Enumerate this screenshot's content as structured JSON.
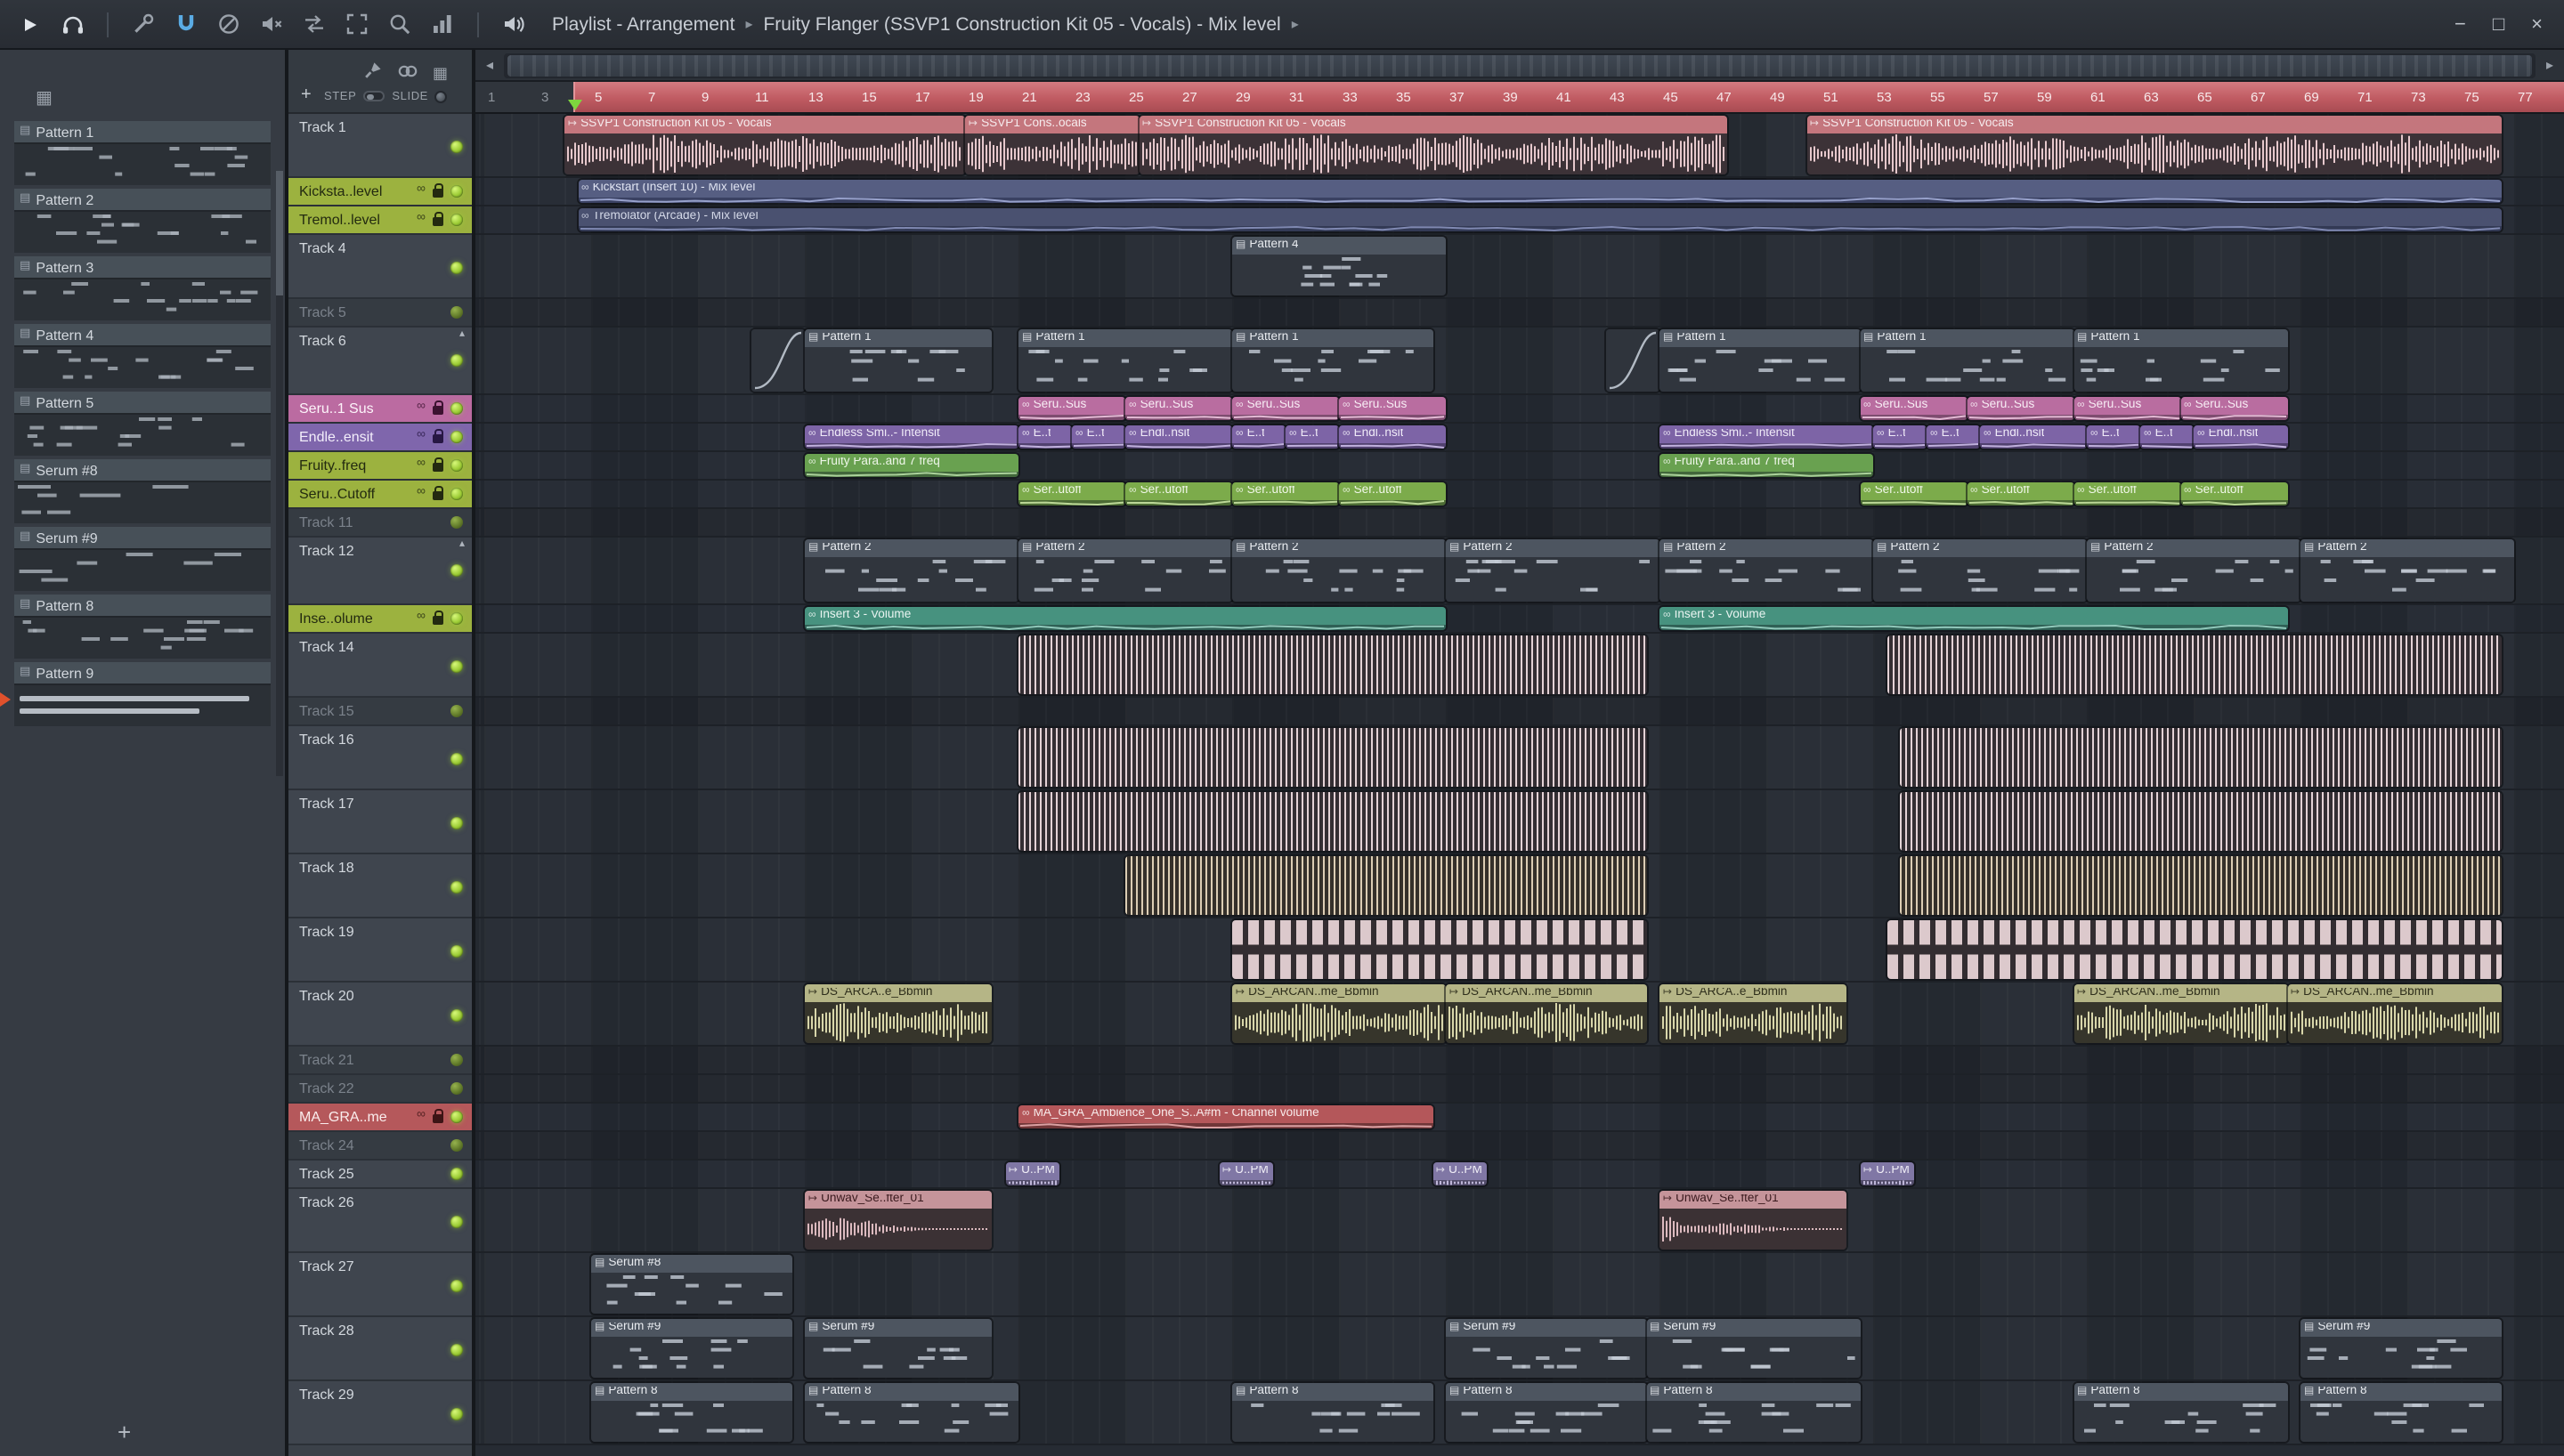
{
  "window": {
    "breadcrumb": {
      "segments": [
        "Playlist - Arrangement",
        "Fruity Flanger (SSVP1 Construction Kit 05 - Vocals) - Mix level"
      ],
      "separator": "▸"
    },
    "controls": {
      "minimize": "−",
      "maximize": "□",
      "close": "×"
    }
  },
  "icons": {
    "pattern": "▤",
    "audio": "↦",
    "auto": "∞",
    "link": "∞",
    "collapse": "▴",
    "grid": "▦"
  },
  "pattern_picker": {
    "items": [
      {
        "name": "Pattern 1",
        "preview": "notes"
      },
      {
        "name": "Pattern 2",
        "preview": "notes"
      },
      {
        "name": "Pattern 3",
        "preview": "notes-sparse"
      },
      {
        "name": "Pattern 4",
        "preview": "notes"
      },
      {
        "name": "Pattern 5",
        "preview": "notes"
      },
      {
        "name": "Serum #8",
        "preview": "notes-long"
      },
      {
        "name": "Serum #9",
        "preview": "notes-long"
      },
      {
        "name": "Pattern 8",
        "preview": "notes"
      },
      {
        "name": "Pattern 9",
        "preview": "bars",
        "playing": true
      }
    ],
    "add_button": "+"
  },
  "playlist_toolbar": {
    "add_button": "+",
    "step_label": "STEP",
    "slide_label": "SLIDE",
    "scroll_left": "◂",
    "scroll_right": "▸"
  },
  "timeline": {
    "bar_labels": [
      1,
      3,
      5,
      7,
      9,
      11,
      13,
      15,
      17,
      19,
      21,
      23,
      25,
      27,
      29,
      31,
      33,
      35,
      37,
      39,
      41,
      43,
      45,
      47,
      49,
      51,
      53,
      55,
      57,
      59,
      61,
      63,
      65,
      67,
      69,
      71,
      73,
      75,
      77
    ],
    "loop_start_bar": 4.3,
    "playhead_bar": 4.4
  },
  "tracks": [
    {
      "name": "Track 1",
      "kind": "tall",
      "h": 36
    },
    {
      "name": "Kicksta..level",
      "kind": "auto",
      "h": 16,
      "color": "green"
    },
    {
      "name": "Tremol..level",
      "kind": "auto",
      "h": 16,
      "color": "green"
    },
    {
      "name": "Track 4",
      "kind": "tall",
      "h": 36
    },
    {
      "name": "Track 5",
      "kind": "dim",
      "h": 16
    },
    {
      "name": "Track 6",
      "kind": "tall",
      "h": 38,
      "arrow": true
    },
    {
      "name": "Seru..1 Sus",
      "kind": "auto",
      "h": 16,
      "color": "magenta"
    },
    {
      "name": "Endle..ensit",
      "kind": "auto",
      "h": 16,
      "color": "purple"
    },
    {
      "name": "Fruity..freq",
      "kind": "auto",
      "h": 16,
      "color": "green"
    },
    {
      "name": "Seru..Cutoff",
      "kind": "auto",
      "h": 16,
      "color": "green"
    },
    {
      "name": "Track 11",
      "kind": "dim",
      "h": 16
    },
    {
      "name": "Track 12",
      "kind": "tall",
      "h": 38,
      "arrow": true
    },
    {
      "name": "Inse..olume",
      "kind": "auto",
      "h": 16,
      "color": "green"
    },
    {
      "name": "Track 14",
      "kind": "tall",
      "h": 36
    },
    {
      "name": "Track 15",
      "kind": "dim",
      "h": 16
    },
    {
      "name": "Track 16",
      "kind": "tall",
      "h": 36
    },
    {
      "name": "Track 17",
      "kind": "tall",
      "h": 36
    },
    {
      "name": "Track 18",
      "kind": "tall",
      "h": 36
    },
    {
      "name": "Track 19",
      "kind": "tall",
      "h": 36
    },
    {
      "name": "Track 20",
      "kind": "tall",
      "h": 36
    },
    {
      "name": "Track 21",
      "kind": "dim",
      "h": 16
    },
    {
      "name": "Track 22",
      "kind": "dim",
      "h": 16
    },
    {
      "name": "MA_GRA..me",
      "kind": "auto",
      "h": 16,
      "color": "red"
    },
    {
      "name": "Track 24",
      "kind": "dim",
      "h": 16
    },
    {
      "name": "Track 25",
      "kind": "small",
      "h": 16
    },
    {
      "name": "Track 26",
      "kind": "tall",
      "h": 36
    },
    {
      "name": "Track 27",
      "kind": "tall",
      "h": 36
    },
    {
      "name": "Track 28",
      "kind": "tall",
      "h": 36
    },
    {
      "name": "Track 29",
      "kind": "tall",
      "h": 36
    }
  ],
  "track_colors": {
    "green": {
      "bg": "#9cb23f",
      "text": "#232a10",
      "ink": "#232a10"
    },
    "magenta": {
      "bg": "#bb6ba1",
      "text": "#fdf4fa",
      "ink": "#3c1230"
    },
    "purple": {
      "bg": "#7f66ac",
      "text": "#f3eefb",
      "ink": "#271743"
    },
    "red": {
      "bg": "#b5585b",
      "text": "#faeded",
      "ink": "#3d1415"
    }
  },
  "palettes": {
    "vocal": {
      "head": "#c4767d",
      "text": "#f6ecee",
      "body": "#3c3237",
      "wave": "#e6c8cc"
    },
    "indigo": {
      "head": "#565e82",
      "text": "#e0e4f2",
      "body": "#3a4162",
      "line": "#98a2cc"
    },
    "indigo2": {
      "head": "#4a5170",
      "text": "#d4d9e8",
      "body": "#333a55",
      "line": "#8089b2"
    },
    "gray": {
      "head": "#4d5560",
      "text": "#e9ecf0",
      "body": "#30353d",
      "note": "#c3cbd4"
    },
    "grayc": {
      "head": "#454c56",
      "text": "#dfe3e8",
      "body": "#2f343c",
      "line": "#b2bac4"
    },
    "magenta": {
      "head": "#b96da0",
      "text": "#f8eef5",
      "body": "#7e4d70",
      "line": "#e3b9d4"
    },
    "purple": {
      "head": "#7d64a6",
      "text": "#f0ebf8",
      "body": "#51416f",
      "line": "#c0b0dd"
    },
    "green": {
      "head": "#69a150",
      "text": "#eef6e9",
      "body": "#42673b",
      "line": "#abd29b"
    },
    "green2": {
      "head": "#7cab4b",
      "text": "#f1f7e9",
      "body": "#4c6b34",
      "line": "#bcd897"
    },
    "teal": {
      "head": "#47927f",
      "text": "#e9f4f1",
      "body": "#2f6055",
      "line": "#90c8ba"
    },
    "red": {
      "head": "#b4575a",
      "text": "#f8ebeb",
      "body": "#703638",
      "line": "#daa0a2"
    },
    "lavender": {
      "head": "#8077a5",
      "text": "#f0eef7",
      "body": "#514b69",
      "wave": "#beb6d8"
    },
    "rose": {
      "head": "#c5949a",
      "text": "#39191d",
      "body": "#3b3134",
      "wave": "#dcbabf"
    },
    "olive": {
      "head": "#b5b586",
      "text": "#2f2f1c",
      "body": "#36352b",
      "wave": "#d8d6aa"
    },
    "stripepink": {
      "stripe": "#e4d2d6",
      "bg": "#342e33"
    },
    "stripetan": {
      "stripe": "#dccdb4",
      "bg": "#35302a"
    },
    "blocks": {
      "stripe": "#dcc9cc",
      "bg": "#332d31"
    }
  },
  "colors": {
    "ruler_red": "#c05b62",
    "led_green": "#a8d93c",
    "grid_bg": "#262b33",
    "panel_bg": "#3b4149",
    "sidebar_bg": "#363b43"
  },
  "clips": [
    {
      "t": 1,
      "s": 4,
      "e": 19,
      "label": "SSVP1 Construction Kit 05 - Vocals",
      "type": "audio",
      "pal": "vocal"
    },
    {
      "t": 1,
      "s": 19,
      "e": 25.5,
      "label": "SSVP1 Cons..ocals",
      "type": "audio",
      "pal": "vocal"
    },
    {
      "t": 1,
      "s": 25.5,
      "e": 47.5,
      "label": "SSVP1 Construction Kit 05 - Vocals",
      "type": "audio",
      "pal": "vocal"
    },
    {
      "t": 1,
      "s": 50.5,
      "e": 76.5,
      "label": "SSVP1 Construction Kit 05 - Vocals",
      "type": "audio",
      "pal": "vocal"
    },
    {
      "t": 2,
      "s": 4.5,
      "e": 76.5,
      "label": "Kickstart (Insert 10) - Mix level",
      "type": "auto",
      "pal": "indigo"
    },
    {
      "t": 3,
      "s": 4.5,
      "e": 76.5,
      "label": "Tremolator (Arcade) - Mix level",
      "type": "auto",
      "pal": "indigo2"
    },
    {
      "t": 4,
      "s": 29,
      "e": 37,
      "label": "Pattern 4",
      "type": "pattern",
      "pal": "gray"
    },
    {
      "t": 6,
      "s": 11,
      "e": 13,
      "label": "",
      "type": "curve",
      "pal": "grayc"
    },
    {
      "t": 6,
      "s": 13,
      "e": 20,
      "label": "Pattern 1",
      "type": "pattern",
      "pal": "gray"
    },
    {
      "t": 6,
      "s": 21,
      "e": 29,
      "label": "Pattern 1",
      "type": "pattern",
      "pal": "gray"
    },
    {
      "t": 6,
      "s": 29,
      "e": 36.5,
      "label": "Pattern 1",
      "type": "pattern",
      "pal": "gray"
    },
    {
      "t": 6,
      "s": 43,
      "e": 45,
      "label": "",
      "type": "curve",
      "pal": "grayc"
    },
    {
      "t": 6,
      "s": 45,
      "e": 52.5,
      "label": "Pattern 1",
      "type": "pattern",
      "pal": "gray"
    },
    {
      "t": 6,
      "s": 52.5,
      "e": 60.5,
      "label": "Pattern 1",
      "type": "pattern",
      "pal": "gray"
    },
    {
      "t": 6,
      "s": 60.5,
      "e": 68.5,
      "label": "Pattern 1",
      "type": "pattern",
      "pal": "gray"
    },
    {
      "t": 7,
      "s": 21,
      "e": 25,
      "label": "Seru..Sus",
      "type": "auto",
      "pal": "magenta"
    },
    {
      "t": 7,
      "s": 25,
      "e": 29,
      "label": "Seru..Sus",
      "type": "auto",
      "pal": "magenta"
    },
    {
      "t": 7,
      "s": 29,
      "e": 33,
      "label": "Seru..Sus",
      "type": "auto",
      "pal": "magenta"
    },
    {
      "t": 7,
      "s": 33,
      "e": 37,
      "label": "Seru..Sus",
      "type": "auto",
      "pal": "magenta"
    },
    {
      "t": 7,
      "s": 52.5,
      "e": 56.5,
      "label": "Seru..Sus",
      "type": "auto",
      "pal": "magenta"
    },
    {
      "t": 7,
      "s": 56.5,
      "e": 60.5,
      "label": "Seru..Sus",
      "type": "auto",
      "pal": "magenta"
    },
    {
      "t": 7,
      "s": 60.5,
      "e": 64.5,
      "label": "Seru..Sus",
      "type": "auto",
      "pal": "magenta"
    },
    {
      "t": 7,
      "s": 64.5,
      "e": 68.5,
      "label": "Seru..Sus",
      "type": "auto",
      "pal": "magenta"
    },
    {
      "t": 8,
      "s": 13,
      "e": 21,
      "label": "Endless Smi..- Intensit",
      "type": "auto",
      "pal": "purple"
    },
    {
      "t": 8,
      "s": 21,
      "e": 23,
      "label": "E..t",
      "type": "auto",
      "pal": "purple"
    },
    {
      "t": 8,
      "s": 23,
      "e": 25,
      "label": "E..t",
      "type": "auto",
      "pal": "purple"
    },
    {
      "t": 8,
      "s": 25,
      "e": 29,
      "label": "Endl..nsit",
      "type": "auto",
      "pal": "purple"
    },
    {
      "t": 8,
      "s": 29,
      "e": 31,
      "label": "E..t",
      "type": "auto",
      "pal": "purple"
    },
    {
      "t": 8,
      "s": 31,
      "e": 33,
      "label": "E..t",
      "type": "auto",
      "pal": "purple"
    },
    {
      "t": 8,
      "s": 33,
      "e": 37,
      "label": "Endl..nsit",
      "type": "auto",
      "pal": "purple"
    },
    {
      "t": 8,
      "s": 45,
      "e": 53,
      "label": "Endless Smi..- Intensit",
      "type": "auto",
      "pal": "purple"
    },
    {
      "t": 8,
      "s": 53,
      "e": 55,
      "label": "E..t",
      "type": "auto",
      "pal": "purple"
    },
    {
      "t": 8,
      "s": 55,
      "e": 57,
      "label": "E..t",
      "type": "auto",
      "pal": "purple"
    },
    {
      "t": 8,
      "s": 57,
      "e": 61,
      "label": "Endl..nsit",
      "type": "auto",
      "pal": "purple"
    },
    {
      "t": 8,
      "s": 61,
      "e": 63,
      "label": "E..t",
      "type": "auto",
      "pal": "purple"
    },
    {
      "t": 8,
      "s": 63,
      "e": 65,
      "label": "E..t",
      "type": "auto",
      "pal": "purple"
    },
    {
      "t": 8,
      "s": 65,
      "e": 68.5,
      "label": "Endl..nsit",
      "type": "auto",
      "pal": "purple"
    },
    {
      "t": 9,
      "s": 13,
      "e": 21,
      "label": "Fruity Para..and 7 freq",
      "type": "auto",
      "pal": "green"
    },
    {
      "t": 9,
      "s": 45,
      "e": 53,
      "label": "Fruity Para..and 7 freq",
      "type": "auto",
      "pal": "green"
    },
    {
      "t": 10,
      "s": 21,
      "e": 25,
      "label": "Ser..utoff",
      "type": "auto",
      "pal": "green2"
    },
    {
      "t": 10,
      "s": 25,
      "e": 29,
      "label": "Ser..utoff",
      "type": "auto",
      "pal": "green2"
    },
    {
      "t": 10,
      "s": 29,
      "e": 33,
      "label": "Ser..utoff",
      "type": "auto",
      "pal": "green2"
    },
    {
      "t": 10,
      "s": 33,
      "e": 37,
      "label": "Ser..utoff",
      "type": "auto",
      "pal": "green2"
    },
    {
      "t": 10,
      "s": 52.5,
      "e": 56.5,
      "label": "Ser..utoff",
      "type": "auto",
      "pal": "green2"
    },
    {
      "t": 10,
      "s": 56.5,
      "e": 60.5,
      "label": "Ser..utoff",
      "type": "auto",
      "pal": "green2"
    },
    {
      "t": 10,
      "s": 60.5,
      "e": 64.5,
      "label": "Ser..utoff",
      "type": "auto",
      "pal": "green2"
    },
    {
      "t": 10,
      "s": 64.5,
      "e": 68.5,
      "label": "Ser..utoff",
      "type": "auto",
      "pal": "green2"
    },
    {
      "t": 12,
      "s": 13,
      "e": 21,
      "label": "Pattern 2",
      "type": "pattern",
      "pal": "gray"
    },
    {
      "t": 12,
      "s": 21,
      "e": 29,
      "label": "Pattern 2",
      "type": "pattern",
      "pal": "gray"
    },
    {
      "t": 12,
      "s": 29,
      "e": 37,
      "label": "Pattern 2",
      "type": "pattern",
      "pal": "gray"
    },
    {
      "t": 12,
      "s": 37,
      "e": 45,
      "label": "Pattern 2",
      "type": "pattern",
      "pal": "gray"
    },
    {
      "t": 12,
      "s": 45,
      "e": 53,
      "label": "Pattern 2",
      "type": "pattern",
      "pal": "gray"
    },
    {
      "t": 12,
      "s": 53,
      "e": 61,
      "label": "Pattern 2",
      "type": "pattern",
      "pal": "gray"
    },
    {
      "t": 12,
      "s": 61,
      "e": 69,
      "label": "Pattern 2",
      "type": "pattern",
      "pal": "gray"
    },
    {
      "t": 12,
      "s": 69,
      "e": 77,
      "label": "Pattern 2",
      "type": "pattern",
      "pal": "gray"
    },
    {
      "t": 13,
      "s": 13,
      "e": 37,
      "label": "Insert 3 - Volume",
      "type": "auto",
      "pal": "teal"
    },
    {
      "t": 13,
      "s": 45,
      "e": 68.5,
      "label": "Insert 3 - Volume",
      "type": "auto",
      "pal": "teal"
    },
    {
      "t": 14,
      "s": 21,
      "e": 44.5,
      "label": "",
      "type": "stripes",
      "pal": "stripepink"
    },
    {
      "t": 14,
      "s": 53.5,
      "e": 76.5,
      "label": "",
      "type": "stripes",
      "pal": "stripepink"
    },
    {
      "t": 16,
      "s": 21,
      "e": 44.5,
      "label": "",
      "type": "stripes",
      "pal": "stripepink"
    },
    {
      "t": 16,
      "s": 54,
      "e": 76.5,
      "label": "",
      "type": "stripes",
      "pal": "stripepink"
    },
    {
      "t": 17,
      "s": 21,
      "e": 44.5,
      "label": "",
      "type": "stripes",
      "pal": "stripepink"
    },
    {
      "t": 17,
      "s": 54,
      "e": 76.5,
      "label": "",
      "type": "stripes",
      "pal": "stripepink"
    },
    {
      "t": 18,
      "s": 25,
      "e": 44.5,
      "label": "",
      "type": "stripes",
      "pal": "stripetan"
    },
    {
      "t": 18,
      "s": 54,
      "e": 76.5,
      "label": "",
      "type": "stripes",
      "pal": "stripetan"
    },
    {
      "t": 19,
      "s": 29,
      "e": 44.5,
      "label": "",
      "type": "blocks",
      "pal": "blocks"
    },
    {
      "t": 19,
      "s": 53.5,
      "e": 76.5,
      "label": "",
      "type": "blocks",
      "pal": "blocks"
    },
    {
      "t": 20,
      "s": 13,
      "e": 20,
      "label": "DS_ARCA..e_Bbmin",
      "type": "audio",
      "pal": "olive"
    },
    {
      "t": 20,
      "s": 29,
      "e": 37,
      "label": "DS_ARCAN..me_Bbmin",
      "type": "audio",
      "pal": "olive"
    },
    {
      "t": 20,
      "s": 37,
      "e": 44.5,
      "label": "DS_ARCAN..me_Bbmin",
      "type": "audio",
      "pal": "olive"
    },
    {
      "t": 20,
      "s": 45,
      "e": 52,
      "label": "DS_ARCA..e_Bbmin",
      "type": "audio",
      "pal": "olive"
    },
    {
      "t": 20,
      "s": 60.5,
      "e": 68.5,
      "label": "DS_ARCAN..me_Bbmin",
      "type": "audio",
      "pal": "olive"
    },
    {
      "t": 20,
      "s": 68.5,
      "e": 76.5,
      "label": "DS_ARCAN..me_Bbmin",
      "type": "audio",
      "pal": "olive"
    },
    {
      "t": 23,
      "s": 21,
      "e": 36.5,
      "label": "MA_GRA_Ambience_One_S..A#m - Channel volume",
      "type": "auto",
      "pal": "red"
    },
    {
      "t": 25,
      "s": 20.5,
      "e": 22.5,
      "label": "U..PM",
      "type": "audio",
      "pal": "lavender"
    },
    {
      "t": 25,
      "s": 28.5,
      "e": 30.5,
      "label": "U..PM",
      "type": "audio",
      "pal": "lavender"
    },
    {
      "t": 25,
      "s": 36.5,
      "e": 38.5,
      "label": "U..PM",
      "type": "audio",
      "pal": "lavender"
    },
    {
      "t": 25,
      "s": 52.5,
      "e": 54.5,
      "label": "U..PM",
      "type": "audio",
      "pal": "lavender"
    },
    {
      "t": 26,
      "s": 13,
      "e": 20,
      "label": "Unwav_Se..fter_01",
      "type": "adecay",
      "pal": "rose"
    },
    {
      "t": 26,
      "s": 45,
      "e": 52,
      "label": "Unwav_Se..fter_01",
      "type": "adecay",
      "pal": "rose"
    },
    {
      "t": 27,
      "s": 5,
      "e": 12.5,
      "label": "Serum #8",
      "type": "pattern",
      "pal": "gray"
    },
    {
      "t": 28,
      "s": 5,
      "e": 12.5,
      "label": "Serum #9",
      "type": "pattern",
      "pal": "gray"
    },
    {
      "t": 28,
      "s": 13,
      "e": 20,
      "label": "Serum #9",
      "type": "pattern",
      "pal": "gray"
    },
    {
      "t": 28,
      "s": 37,
      "e": 44.5,
      "label": "Serum #9",
      "type": "pattern",
      "pal": "gray"
    },
    {
      "t": 28,
      "s": 44.5,
      "e": 52.5,
      "label": "Serum #9",
      "type": "pattern",
      "pal": "gray"
    },
    {
      "t": 28,
      "s": 69,
      "e": 76.5,
      "label": "Serum #9",
      "type": "pattern",
      "pal": "gray"
    },
    {
      "t": 29,
      "s": 5,
      "e": 12.5,
      "label": "Pattern 8",
      "type": "pattern",
      "pal": "gray"
    },
    {
      "t": 29,
      "s": 13,
      "e": 21,
      "label": "Pattern 8",
      "type": "pattern",
      "pal": "gray"
    },
    {
      "t": 29,
      "s": 29,
      "e": 36.5,
      "label": "Pattern 8",
      "type": "pattern",
      "pal": "gray"
    },
    {
      "t": 29,
      "s": 37,
      "e": 44.5,
      "label": "Pattern 8",
      "type": "pattern",
      "pal": "gray"
    },
    {
      "t": 29,
      "s": 44.5,
      "e": 52.5,
      "label": "Pattern 8",
      "type": "pattern",
      "pal": "gray"
    },
    {
      "t": 29,
      "s": 60.5,
      "e": 68.5,
      "label": "Pattern 8",
      "type": "pattern",
      "pal": "gray"
    },
    {
      "t": 29,
      "s": 69,
      "e": 76.5,
      "label": "Pattern 8",
      "type": "pattern",
      "pal": "gray"
    }
  ]
}
